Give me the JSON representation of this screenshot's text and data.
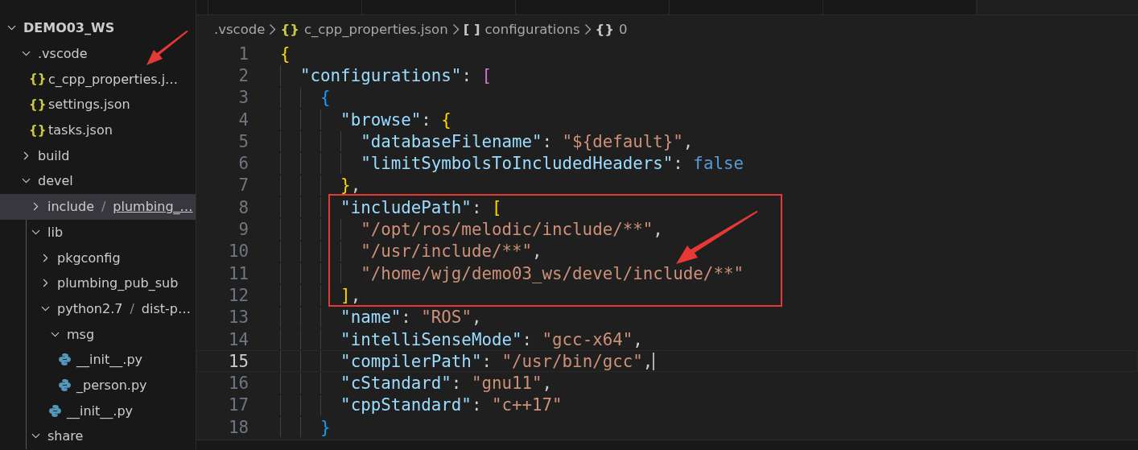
{
  "sidebar": {
    "tree": [
      {
        "label": "DEMO03_WS",
        "kind": "root",
        "expanded": true,
        "selected": false,
        "children": [
          {
            "label": ".vscode",
            "kind": "folder",
            "expanded": true,
            "selected": false,
            "children": [
              {
                "label": "c_cpp_properties.j…",
                "kind": "json",
                "icon": "{}",
                "selected": false
              },
              {
                "label": "settings.json",
                "kind": "json",
                "icon": "{}",
                "selected": false
              },
              {
                "label": "tasks.json",
                "kind": "json",
                "icon": "{}",
                "selected": false
              }
            ]
          },
          {
            "label": "build",
            "kind": "folder",
            "expanded": false,
            "selected": false
          },
          {
            "label": "devel",
            "kind": "folder",
            "expanded": true,
            "selected": false,
            "children": [
              {
                "kind": "compact",
                "segments": [
                  "include",
                  "plumbing_…"
                ],
                "separator": "/",
                "expanded": false,
                "selected": true
              },
              {
                "label": "lib",
                "kind": "folder",
                "expanded": true,
                "selected": false,
                "children": [
                  {
                    "label": "pkgconfig",
                    "kind": "folder",
                    "expanded": false,
                    "selected": false
                  },
                  {
                    "label": "plumbing_pub_sub",
                    "kind": "folder",
                    "expanded": false,
                    "selected": false
                  },
                  {
                    "kind": "compact",
                    "segments": [
                      "python2.7",
                      "dist-p…"
                    ],
                    "separator": "/",
                    "expanded": true,
                    "selected": false,
                    "children": [
                      {
                        "label": "msg",
                        "kind": "folder",
                        "expanded": true,
                        "selected": false,
                        "children": [
                          {
                            "label": "__init__.py",
                            "kind": "python",
                            "selected": false
                          },
                          {
                            "label": "_person.py",
                            "kind": "python",
                            "selected": false
                          }
                        ]
                      },
                      {
                        "label": "__init__.py",
                        "kind": "python",
                        "selected": false
                      }
                    ]
                  }
                ]
              },
              {
                "label": "share",
                "kind": "folder",
                "expanded": true,
                "selected": false
              }
            ]
          }
        ]
      }
    ]
  },
  "tabs": [
    {
      "selected": false
    },
    {
      "selected": false
    },
    {
      "selected": false
    },
    {
      "selected": false
    },
    {
      "selected": false
    },
    {
      "selected": true
    }
  ],
  "breadcrumbs": [
    {
      "label": ".vscode"
    },
    {
      "label": "c_cpp_properties.json",
      "icon": "{}",
      "kind": "file"
    },
    {
      "label": "configurations",
      "icon": "[ ]",
      "kind": "array"
    },
    {
      "label": "0",
      "icon": "{}",
      "kind": "object"
    }
  ],
  "editor": {
    "lines": [
      {
        "number": "1",
        "current": false,
        "tokens": [
          {
            "text": "{",
            "kind": "bracket",
            "color": "#ffd700"
          }
        ]
      },
      {
        "number": "2",
        "current": false,
        "tokens": [
          {
            "text": "  \"configurations\"",
            "kind": "key"
          },
          {
            "text": ": ",
            "kind": "punct"
          },
          {
            "text": "[",
            "kind": "bracket",
            "color": "#da70d6"
          }
        ]
      },
      {
        "number": "3",
        "current": false,
        "tokens": [
          {
            "text": "    {",
            "kind": "bracket",
            "color": "#179fff"
          }
        ]
      },
      {
        "number": "4",
        "current": false,
        "tokens": [
          {
            "text": "      \"browse\"",
            "kind": "key"
          },
          {
            "text": ": ",
            "kind": "punct"
          },
          {
            "text": "{",
            "kind": "bracket",
            "color": "#ffd700"
          }
        ]
      },
      {
        "number": "5",
        "current": false,
        "tokens": [
          {
            "text": "        \"databaseFilename\"",
            "kind": "key"
          },
          {
            "text": ": ",
            "kind": "punct"
          },
          {
            "text": "\"${default}\"",
            "kind": "string"
          },
          {
            "text": ",",
            "kind": "punct"
          }
        ]
      },
      {
        "number": "6",
        "current": false,
        "tokens": [
          {
            "text": "        \"limitSymbolsToIncludedHeaders\"",
            "kind": "key"
          },
          {
            "text": ": ",
            "kind": "punct"
          },
          {
            "text": "false",
            "kind": "bool"
          }
        ]
      },
      {
        "number": "7",
        "current": false,
        "tokens": [
          {
            "text": "      }",
            "kind": "bracket",
            "color": "#ffd700"
          },
          {
            "text": ",",
            "kind": "punct"
          }
        ]
      },
      {
        "number": "8",
        "current": false,
        "tokens": [
          {
            "text": "      \"includePath\"",
            "kind": "key"
          },
          {
            "text": ": ",
            "kind": "punct"
          },
          {
            "text": "[",
            "kind": "bracket",
            "color": "#ffd700"
          }
        ]
      },
      {
        "number": "9",
        "current": false,
        "tokens": [
          {
            "text": "        \"/opt/ros/melodic/include/**\"",
            "kind": "string"
          },
          {
            "text": ",",
            "kind": "punct"
          }
        ]
      },
      {
        "number": "10",
        "current": false,
        "tokens": [
          {
            "text": "        \"/usr/include/**\"",
            "kind": "string"
          },
          {
            "text": ",",
            "kind": "punct"
          }
        ]
      },
      {
        "number": "11",
        "current": false,
        "tokens": [
          {
            "text": "        \"/home/wjg/demo03_ws/devel/include/**\"",
            "kind": "string"
          }
        ]
      },
      {
        "number": "12",
        "current": false,
        "tokens": [
          {
            "text": "      ]",
            "kind": "bracket",
            "color": "#ffd700"
          },
          {
            "text": ",",
            "kind": "punct"
          }
        ]
      },
      {
        "number": "13",
        "current": false,
        "tokens": [
          {
            "text": "      \"name\"",
            "kind": "key"
          },
          {
            "text": ": ",
            "kind": "punct"
          },
          {
            "text": "\"ROS\"",
            "kind": "string"
          },
          {
            "text": ",",
            "kind": "punct"
          }
        ]
      },
      {
        "number": "14",
        "current": false,
        "tokens": [
          {
            "text": "      \"intelliSenseMode\"",
            "kind": "key"
          },
          {
            "text": ": ",
            "kind": "punct"
          },
          {
            "text": "\"gcc-x64\"",
            "kind": "string"
          },
          {
            "text": ",",
            "kind": "punct"
          }
        ]
      },
      {
        "number": "15",
        "current": true,
        "tokens": [
          {
            "text": "      \"compilerPath\"",
            "kind": "key"
          },
          {
            "text": ": ",
            "kind": "punct"
          },
          {
            "text": "\"/usr/bin/gcc\"",
            "kind": "string"
          },
          {
            "text": ",",
            "kind": "punct"
          }
        ]
      },
      {
        "number": "16",
        "current": false,
        "tokens": [
          {
            "text": "      \"cStandard\"",
            "kind": "key"
          },
          {
            "text": ": ",
            "kind": "punct"
          },
          {
            "text": "\"gnu11\"",
            "kind": "string"
          },
          {
            "text": ",",
            "kind": "punct"
          }
        ]
      },
      {
        "number": "17",
        "current": false,
        "tokens": [
          {
            "text": "      \"cppStandard\"",
            "kind": "key"
          },
          {
            "text": ": ",
            "kind": "punct"
          },
          {
            "text": "\"c++17\"",
            "kind": "string"
          }
        ]
      },
      {
        "number": "18",
        "current": false,
        "tokens": [
          {
            "text": "    }",
            "kind": "bracket",
            "color": "#179fff"
          }
        ]
      }
    ]
  }
}
